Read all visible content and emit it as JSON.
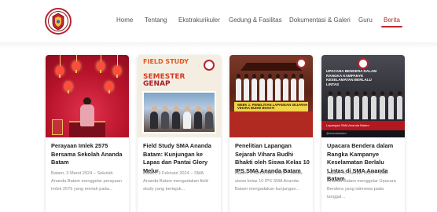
{
  "nav": {
    "items": [
      {
        "label": "Home",
        "active": false
      },
      {
        "label": "Tentang",
        "active": false
      },
      {
        "label": "Ekstrakurikuler",
        "active": false
      },
      {
        "label": "Gedung & Fasilitas",
        "active": false
      },
      {
        "label": "Dokumentasi & Galeri",
        "active": false
      },
      {
        "label": "Guru",
        "active": false
      },
      {
        "label": "Berita",
        "active": true
      }
    ]
  },
  "colors": {
    "accent": "#c0262d"
  },
  "logo": {
    "icon": "school-crest-icon"
  },
  "posts": [
    {
      "title": "Perayaan Imlek 2575 Bersama Sekolah Ananda Batam",
      "excerpt": "Batam, 3 Maret 2024 – Sekolah Ananda Batam menggelar perayaan Imlek 2575 yang meriah pada..."
    },
    {
      "title": "Field Study SMA Ananda Batam: Kunjungan ke Lapas dan Pantai Glory Melur",
      "excerpt": "Batam, 3 Februari 2024 – SMA Ananda Batam mengadakan field study yang bertajuk...",
      "thumb_text": {
        "top": "FIELD STUDY",
        "mid": "SEMESTER",
        "bottom": "GENAP"
      }
    },
    {
      "title": "Penelitian Lapangan Sejarah Vihara Budhi Bhakti oleh Siswa Kelas 10 IPS SMA Ananda Batam",
      "excerpt": "Batam, 8 November 2023 – Siswa-siswa kelas 10 IPS SMA Ananda Batam mengadakan kunjungan...",
      "thumb_text": {
        "banner": "WEEK 1: PENELITIAN LAPANGAN SEJARAH VIHARA BUDHI BHAKTI"
      }
    },
    {
      "title": "Upacara Bendera dalam Rangka Kampanye Keselamatan Berlalu Lintas di SMA Ananda Batam",
      "excerpt": "Batam, 30 Januari 2024 – SMA Ananda Batam menggelar Upacara Bendera yang istimewa pada tanggal...",
      "thumb_text": {
        "caption": "UPACARA BENDERA DALAM RANGKA KAMPANYE KESELAMATAN BERLALU LINTAS",
        "bar": "Lapangan SMA Ananda Batam",
        "footer": "@anandabatam"
      }
    }
  ]
}
